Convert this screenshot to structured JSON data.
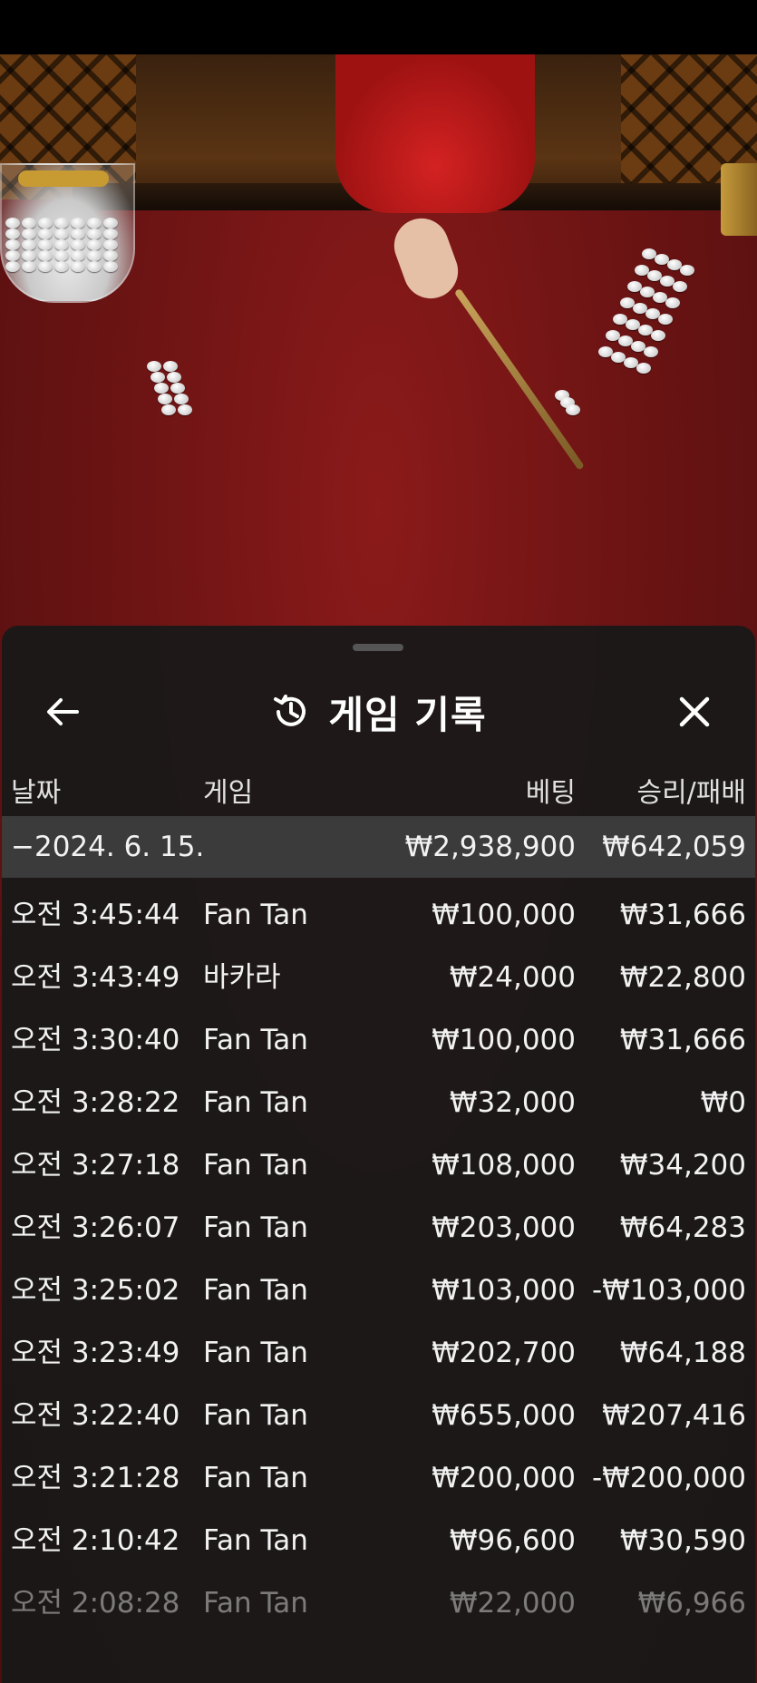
{
  "header": {
    "title": "게임 기록",
    "back_icon": "arrow-left-icon",
    "history_icon": "history-icon",
    "close_icon": "close-icon"
  },
  "columns": {
    "date": "날짜",
    "game": "게임",
    "bet": "베팅",
    "win_loss": "승리/패배"
  },
  "summary": {
    "date": "−2024. 6. 15.",
    "bet": "₩2,938,900",
    "win_loss": "₩642,059"
  },
  "rows": [
    {
      "time": "오전 3:45:44",
      "game": "Fan Tan",
      "bet": "₩100,000",
      "win_loss": "₩31,666"
    },
    {
      "time": "오전 3:43:49",
      "game": "바카라",
      "bet": "₩24,000",
      "win_loss": "₩22,800"
    },
    {
      "time": "오전 3:30:40",
      "game": "Fan Tan",
      "bet": "₩100,000",
      "win_loss": "₩31,666"
    },
    {
      "time": "오전 3:28:22",
      "game": "Fan Tan",
      "bet": "₩32,000",
      "win_loss": "₩0"
    },
    {
      "time": "오전 3:27:18",
      "game": "Fan Tan",
      "bet": "₩108,000",
      "win_loss": "₩34,200"
    },
    {
      "time": "오전 3:26:07",
      "game": "Fan Tan",
      "bet": "₩203,000",
      "win_loss": "₩64,283"
    },
    {
      "time": "오전 3:25:02",
      "game": "Fan Tan",
      "bet": "₩103,000",
      "win_loss": "-₩103,000"
    },
    {
      "time": "오전 3:23:49",
      "game": "Fan Tan",
      "bet": "₩202,700",
      "win_loss": "₩64,188"
    },
    {
      "time": "오전 3:22:40",
      "game": "Fan Tan",
      "bet": "₩655,000",
      "win_loss": "₩207,416"
    },
    {
      "time": "오전 3:21:28",
      "game": "Fan Tan",
      "bet": "₩200,000",
      "win_loss": "-₩200,000"
    },
    {
      "time": "오전 2:10:42",
      "game": "Fan Tan",
      "bet": "₩96,600",
      "win_loss": "₩30,590"
    },
    {
      "time": "오전 2:08:28",
      "game": "Fan Tan",
      "bet": "₩22,000",
      "win_loss": "₩6,966"
    }
  ],
  "colors": {
    "sheet_bg": "#181818",
    "summary_bg": "#3b3b3b",
    "text": "#f2f2f2",
    "felt": "#7a1616"
  }
}
